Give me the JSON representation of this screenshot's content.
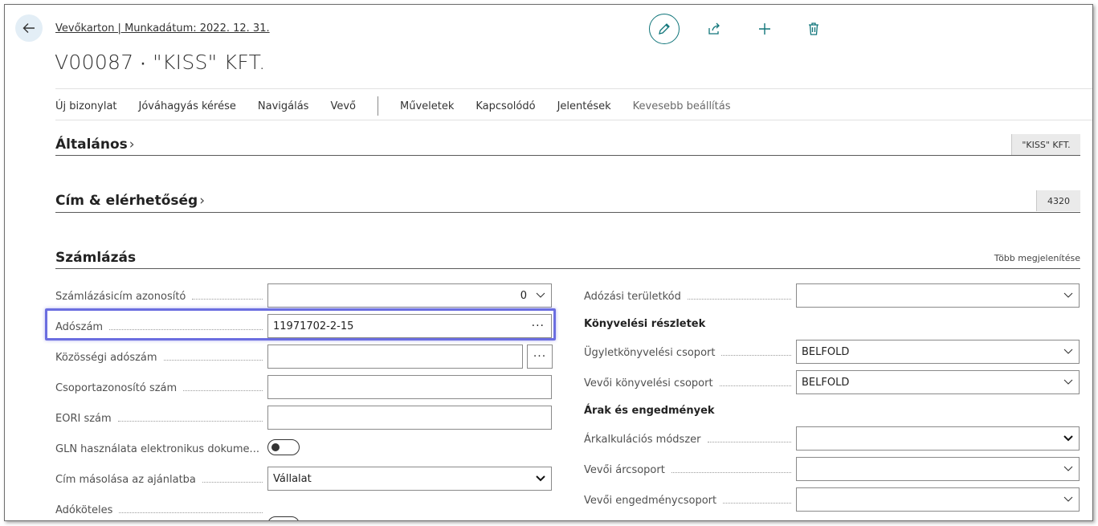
{
  "header": {
    "breadcrumb": "Vevőkarton | Munkadátum: 2022. 12. 31.",
    "title": "V00087 ∙ \"KISS\" KFT."
  },
  "toolbar_icons": [
    "edit-icon",
    "share-icon",
    "plus-icon",
    "trash-icon",
    "back-arrow-icon"
  ],
  "actionbar": {
    "items": [
      "Új bizonylat",
      "Jóváhagyás kérése",
      "Navigálás",
      "Vevő"
    ],
    "items2": [
      "Műveletek",
      "Kapcsolódó",
      "Jelentések",
      "Kevesebb beállítás"
    ]
  },
  "sections": {
    "general": {
      "title": "Általános",
      "summary": "\"KISS\" KFT."
    },
    "address": {
      "title": "Cím & elérhetőség",
      "summary": "4320"
    },
    "invoicing": {
      "title": "Számlázás",
      "more": "Több megjelenítése"
    }
  },
  "left_fields": {
    "billing_id": {
      "label": "Számlázásicím azonosító",
      "value": "0"
    },
    "tax_number": {
      "label": "Adószám",
      "value": "11971702-2-15"
    },
    "eu_tax_number": {
      "label": "Közösségi adószám",
      "value": ""
    },
    "group_id": {
      "label": "Csoportazonosító szám",
      "value": ""
    },
    "eori": {
      "label": "EORI szám",
      "value": ""
    },
    "gln": {
      "label": "GLN használata elektronikus dokume...",
      "value": false
    },
    "copy_address": {
      "label": "Cím másolása az ajánlatba",
      "value": "Vállalat"
    },
    "taxable": {
      "label": "Adóköteles",
      "value": false
    }
  },
  "right_fields": {
    "tax_area": {
      "label": "Adózási területkód",
      "value": ""
    },
    "posting_details_heading": "Könyvelési részletek",
    "gen_bus_posting": {
      "label": "Ügyletkönyvelési csoport",
      "value": "BELFOLD"
    },
    "cust_posting": {
      "label": "Vevői könyvelési csoport",
      "value": "BELFOLD"
    },
    "prices_heading": "Árak és engedmények",
    "price_method": {
      "label": "Árkalkulációs módszer",
      "value": ""
    },
    "price_group": {
      "label": "Vevői árcsoport",
      "value": ""
    },
    "discount_group": {
      "label": "Vevői engedménycsoport",
      "value": ""
    }
  },
  "colors": {
    "accent": "#10757a",
    "highlight": "#6b6ee0"
  }
}
